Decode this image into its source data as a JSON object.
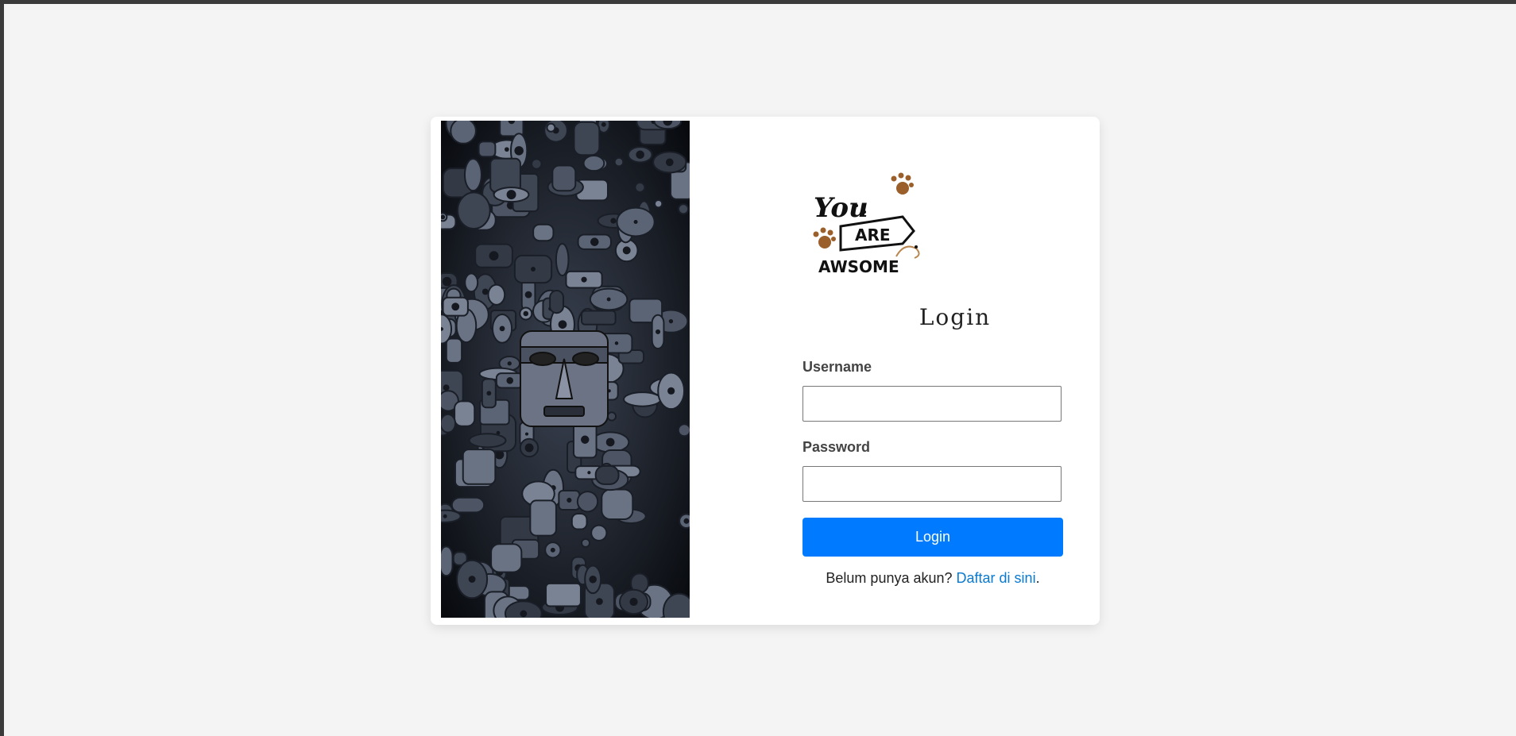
{
  "login": {
    "logo_text_1": "You",
    "logo_text_2": "ARE",
    "logo_text_3": "AWSOME",
    "title": "Login",
    "username_label": "Username",
    "username_value": "",
    "password_label": "Password",
    "password_value": "",
    "button_label": "Login",
    "signup_prompt": "Belum punya akun?",
    "signup_link": "Daftar di sini",
    "signup_period": "."
  },
  "colors": {
    "page_bg": "#f4f4f4",
    "card_bg": "#ffffff",
    "button": "#007bff",
    "link": "#0a7ad0",
    "art_bg": "#0b0e14",
    "paw": "#9a5f2a"
  },
  "icons": {
    "art": "decorative-tribal-mask-pattern",
    "paws": "paw-print-icon"
  }
}
